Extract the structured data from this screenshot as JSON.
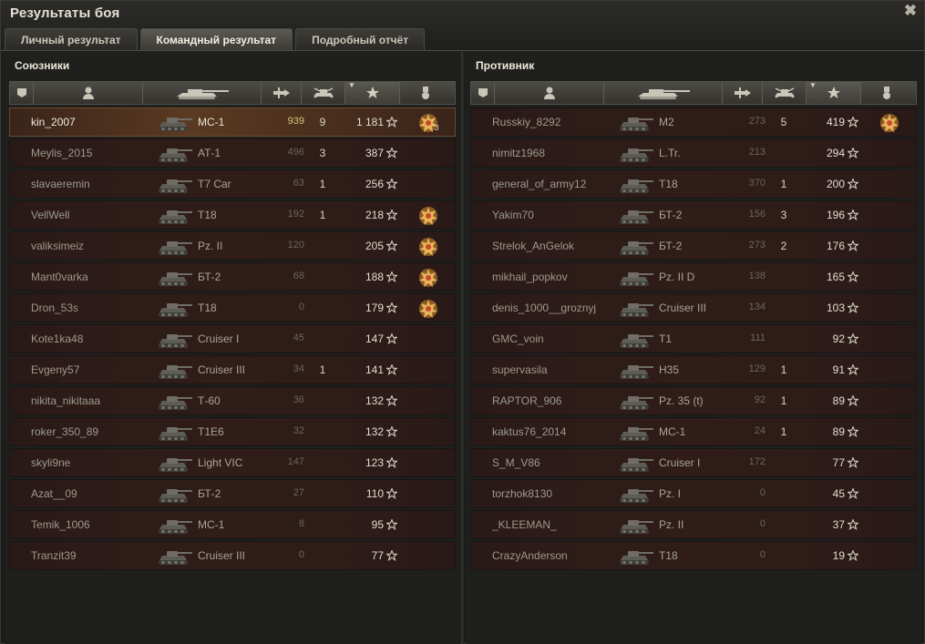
{
  "window": {
    "title": "Результаты боя",
    "close_glyph": "✖"
  },
  "tabs": [
    {
      "label": "Личный результат",
      "active": false
    },
    {
      "label": "Командный результат",
      "active": true
    },
    {
      "label": "Подробный отчёт",
      "active": false
    }
  ],
  "allies": {
    "title": "Союзники",
    "rows": [
      {
        "name": "kin_2007",
        "tank": "МС-1",
        "dmg": "939",
        "frags": "9",
        "xp": "1 181",
        "medal": true,
        "medal_count": "3",
        "me": true
      },
      {
        "name": "Meylis_2015",
        "tank": "АТ-1",
        "dmg": "496",
        "frags": "3",
        "xp": "387",
        "medal": false,
        "medal_count": ""
      },
      {
        "name": "slavaeremin",
        "tank": "T7 Car",
        "dmg": "63",
        "frags": "1",
        "xp": "256",
        "medal": false,
        "medal_count": ""
      },
      {
        "name": "VellWell",
        "tank": "T18",
        "dmg": "192",
        "frags": "1",
        "xp": "218",
        "medal": true,
        "medal_count": ""
      },
      {
        "name": "valiksimeiz",
        "tank": "Pz. II",
        "dmg": "120",
        "frags": "",
        "xp": "205",
        "medal": true,
        "medal_count": ""
      },
      {
        "name": "Mant0varka",
        "tank": "БТ-2",
        "dmg": "68",
        "frags": "",
        "xp": "188",
        "medal": true,
        "medal_count": ""
      },
      {
        "name": "Dron_53s",
        "tank": "T18",
        "dmg": "0",
        "frags": "",
        "xp": "179",
        "medal": true,
        "medal_count": ""
      },
      {
        "name": "Kote1ka48",
        "tank": "Cruiser I",
        "dmg": "45",
        "frags": "",
        "xp": "147",
        "medal": false,
        "medal_count": ""
      },
      {
        "name": "Evgeny57",
        "tank": "Cruiser III",
        "dmg": "34",
        "frags": "1",
        "xp": "141",
        "medal": false,
        "medal_count": ""
      },
      {
        "name": "nikita_nikitaaa",
        "tank": "Т-60",
        "dmg": "36",
        "frags": "",
        "xp": "132",
        "medal": false,
        "medal_count": ""
      },
      {
        "name": "roker_350_89",
        "tank": "T1E6",
        "dmg": "32",
        "frags": "",
        "xp": "132",
        "medal": false,
        "medal_count": ""
      },
      {
        "name": "skyli9ne",
        "tank": "Light VIC",
        "dmg": "147",
        "frags": "",
        "xp": "123",
        "medal": false,
        "medal_count": ""
      },
      {
        "name": "Azat__09",
        "tank": "БТ-2",
        "dmg": "27",
        "frags": "",
        "xp": "110",
        "medal": false,
        "medal_count": ""
      },
      {
        "name": "Temik_1006",
        "tank": "МС-1",
        "dmg": "8",
        "frags": "",
        "xp": "95",
        "medal": false,
        "medal_count": ""
      },
      {
        "name": "Tranzit39",
        "tank": "Cruiser III",
        "dmg": "0",
        "frags": "",
        "xp": "77",
        "medal": false,
        "medal_count": ""
      }
    ]
  },
  "enemies": {
    "title": "Противник",
    "rows": [
      {
        "name": "Russkiy_8292",
        "tank": "M2",
        "dmg": "273",
        "frags": "5",
        "xp": "419",
        "medal": true,
        "medal_count": ""
      },
      {
        "name": "nimitz1968",
        "tank": "L.Tr.",
        "dmg": "213",
        "frags": "",
        "xp": "294",
        "medal": false,
        "medal_count": ""
      },
      {
        "name": "general_of_army12",
        "tank": "T18",
        "dmg": "370",
        "frags": "1",
        "xp": "200",
        "medal": false,
        "medal_count": ""
      },
      {
        "name": "Yakim70",
        "tank": "БТ-2",
        "dmg": "156",
        "frags": "3",
        "xp": "196",
        "medal": false,
        "medal_count": ""
      },
      {
        "name": "Strelok_AnGelok",
        "tank": "БТ-2",
        "dmg": "273",
        "frags": "2",
        "xp": "176",
        "medal": false,
        "medal_count": ""
      },
      {
        "name": "mikhail_popkov",
        "tank": "Pz. II D",
        "dmg": "138",
        "frags": "",
        "xp": "165",
        "medal": false,
        "medal_count": ""
      },
      {
        "name": "denis_1000__groznyj",
        "tank": "Cruiser III",
        "dmg": "134",
        "frags": "",
        "xp": "103",
        "medal": false,
        "medal_count": ""
      },
      {
        "name": "GMC_voin",
        "tank": "T1",
        "dmg": "111",
        "frags": "",
        "xp": "92",
        "medal": false,
        "medal_count": ""
      },
      {
        "name": "supervasila",
        "tank": "H35",
        "dmg": "129",
        "frags": "1",
        "xp": "91",
        "medal": false,
        "medal_count": ""
      },
      {
        "name": "RAPTOR_906",
        "tank": "Pz. 35 (t)",
        "dmg": "92",
        "frags": "1",
        "xp": "89",
        "medal": false,
        "medal_count": ""
      },
      {
        "name": "kaktus76_2014",
        "tank": "МС-1",
        "dmg": "24",
        "frags": "1",
        "xp": "89",
        "medal": false,
        "medal_count": ""
      },
      {
        "name": "S_M_V86",
        "tank": "Cruiser I",
        "dmg": "172",
        "frags": "",
        "xp": "77",
        "medal": false,
        "medal_count": ""
      },
      {
        "name": "torzhok8130",
        "tank": "Pz. I",
        "dmg": "0",
        "frags": "",
        "xp": "45",
        "medal": false,
        "medal_count": ""
      },
      {
        "name": "_KLEEMAN_",
        "tank": "Pz. II",
        "dmg": "0",
        "frags": "",
        "xp": "37",
        "medal": false,
        "medal_count": ""
      },
      {
        "name": "CrazyAnderson",
        "tank": "T18",
        "dmg": "0",
        "frags": "",
        "xp": "19",
        "medal": false,
        "medal_count": ""
      }
    ]
  },
  "columns": [
    {
      "id": "squad",
      "icon": "squad-icon"
    },
    {
      "id": "player",
      "icon": "player-icon"
    },
    {
      "id": "tank",
      "icon": "tank-icon"
    },
    {
      "id": "damage",
      "icon": "damage-icon"
    },
    {
      "id": "frags",
      "icon": "frags-icon"
    },
    {
      "id": "xp",
      "icon": "star-icon",
      "sorted": true
    },
    {
      "id": "medals",
      "icon": "medal-icon"
    }
  ],
  "colors": {
    "accent": "#d9c37a",
    "row_bg": "#2e1c18",
    "highlight": "#5a3a22"
  }
}
